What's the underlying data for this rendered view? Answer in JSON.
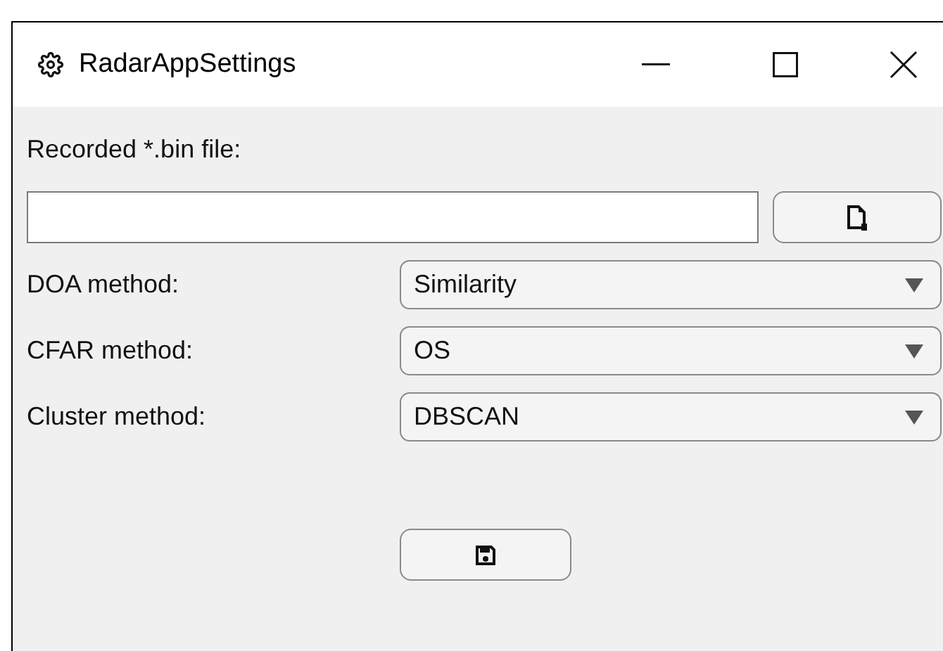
{
  "window": {
    "title": "RadarAppSettings"
  },
  "file": {
    "label": "Recorded *.bin file:"
  },
  "settings": [
    {
      "label": "DOA method:",
      "value": "Similarity"
    },
    {
      "label": "CFAR method:",
      "value": "OS"
    },
    {
      "label": "Cluster method:",
      "value": "DBSCAN"
    }
  ]
}
